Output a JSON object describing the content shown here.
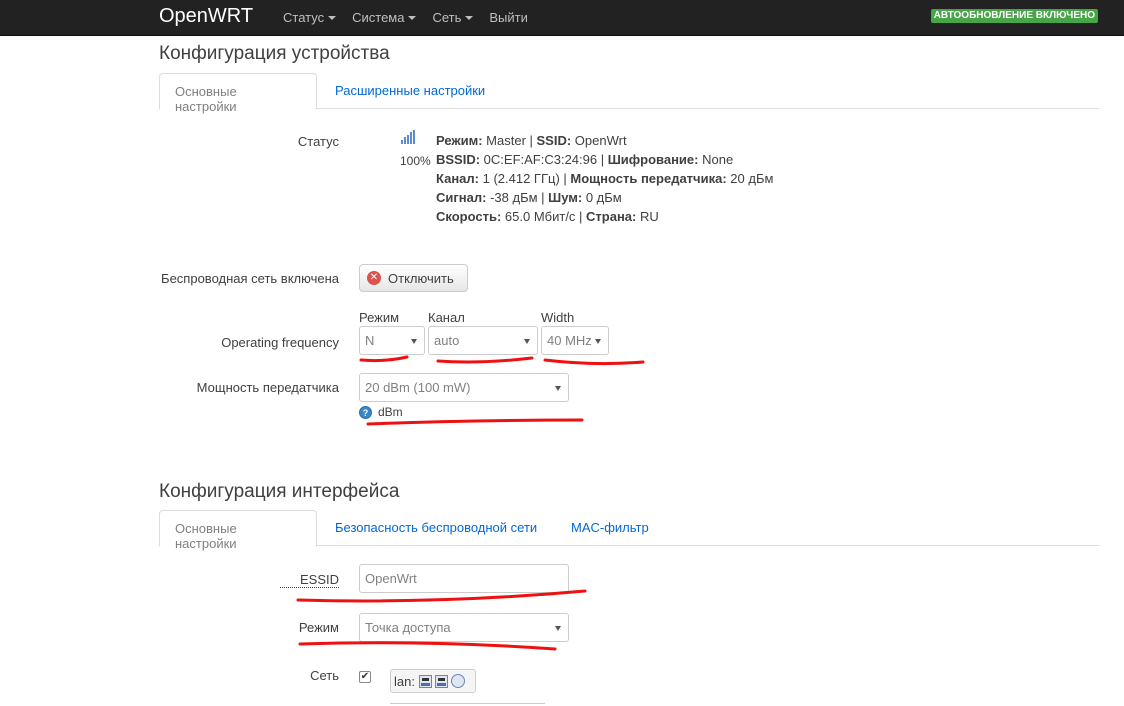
{
  "navbar": {
    "brand": "OpenWRT",
    "menu": [
      {
        "label": "Статус",
        "has_caret": true
      },
      {
        "label": "Система",
        "has_caret": true
      },
      {
        "label": "Сеть",
        "has_caret": true
      },
      {
        "label": "Выйти",
        "has_caret": false
      }
    ],
    "autoupdate_badge": "АВТООБНОВЛЕНИЕ ВКЛЮЧЕНО"
  },
  "device_config": {
    "title": "Конфигурация устройства",
    "tabs": [
      {
        "label": "Основные настройки",
        "active": true
      },
      {
        "label": "Расширенные настройки",
        "active": false
      }
    ],
    "status": {
      "label": "Статус",
      "signal_percent": "100%",
      "lines": [
        [
          {
            "k": "Режим:",
            "v": " Master | "
          },
          {
            "k": "SSID:",
            "v": " OpenWrt"
          }
        ],
        [
          {
            "k": "BSSID:",
            "v": " 0C:EF:AF:C3:24:96 | "
          },
          {
            "k": "Шифрование:",
            "v": " None"
          }
        ],
        [
          {
            "k": "Канал:",
            "v": " 1 (2.412 ГГц) | "
          },
          {
            "k": "Мощность передатчика:",
            "v": " 20 дБм"
          }
        ],
        [
          {
            "k": "Сигнал:",
            "v": " -38 дБм | "
          },
          {
            "k": "Шум:",
            "v": " 0 дБм"
          }
        ],
        [
          {
            "k": "Скорость:",
            "v": " 65.0 Мбит/с | "
          },
          {
            "k": "Страна:",
            "v": " RU"
          }
        ]
      ]
    },
    "wireless_enabled": {
      "label": "Беспроводная сеть включена",
      "button_label": "Отключить"
    },
    "operating_frequency": {
      "label": "Operating frequency",
      "mode_head": "Режим",
      "mode_value": "N",
      "channel_head": "Канал",
      "channel_value": "auto",
      "width_head": "Width",
      "width_value": "40 MHz"
    },
    "tx_power": {
      "label": "Мощность передатчика",
      "value": "20 dBm (100 mW)",
      "help_icon": "?",
      "help_text": "dBm"
    }
  },
  "interface_config": {
    "title": "Конфигурация интерфейса",
    "tabs": [
      {
        "label": "Основные настройки",
        "active": true
      },
      {
        "label": "Безопасность беспроводной сети",
        "active": false
      },
      {
        "label": "MAC-фильтр",
        "active": false
      }
    ],
    "essid": {
      "label": "ESSID",
      "value": "OpenWrt"
    },
    "mode": {
      "label": "Режим",
      "value": "Точка доступа"
    },
    "network": {
      "label": "Сеть",
      "checked": true,
      "badge_label": "lan:",
      "icons": [
        "ethernet-port-icon",
        "ethernet-port-icon",
        "wireless-icon"
      ]
    }
  },
  "colors": {
    "navbar_bg": "#222222",
    "badge_green": "#46a546",
    "link_blue": "#0069d6",
    "annotation_red": "#ee1111"
  },
  "icons": [
    "signal-strength-icon",
    "disable-circle-icon",
    "help-icon",
    "checkbox-check-icon",
    "chevron-down-icon"
  ]
}
